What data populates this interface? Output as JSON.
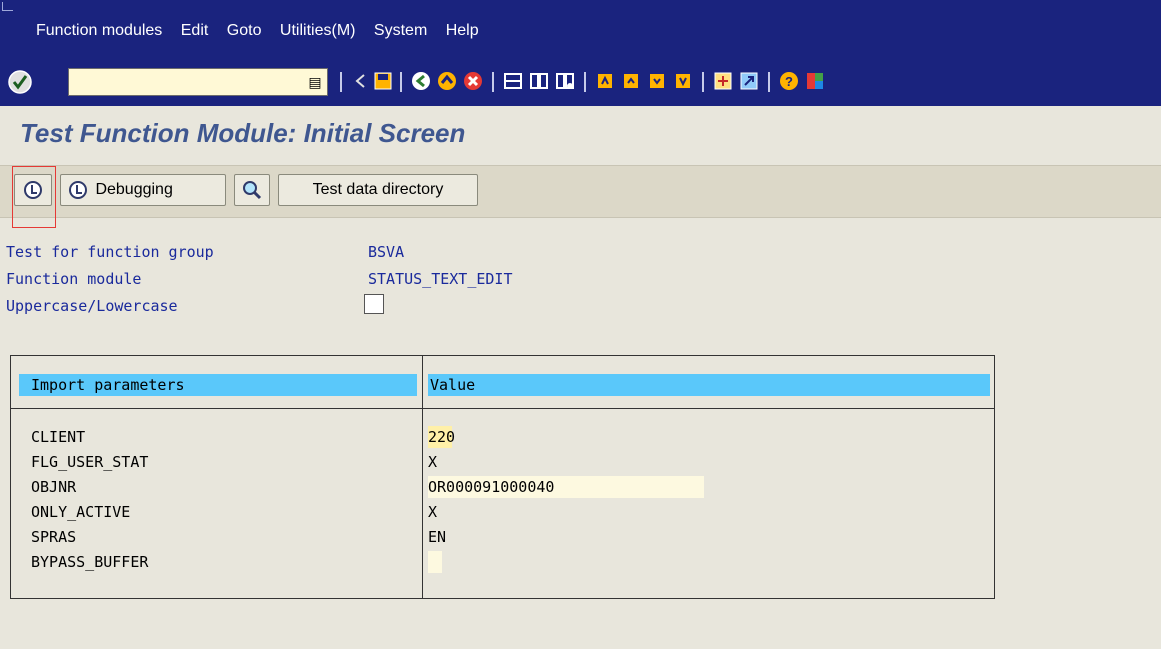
{
  "menu": {
    "items": [
      "Function modules",
      "Edit",
      "Goto",
      "Utilities(M)",
      "System",
      "Help"
    ]
  },
  "toolbar": {
    "command_field_value": "",
    "icons": [
      "enter-icon",
      "back-icon",
      "save-icon",
      "back-green-icon",
      "exit-icon",
      "cancel-icon",
      "print-icon",
      "find-icon",
      "find-next-icon",
      "first-page-icon",
      "prev-page-icon",
      "next-page-icon",
      "last-page-icon",
      "create-session-icon",
      "shortcut-icon",
      "help-icon",
      "customize-layout-icon"
    ]
  },
  "title": "Test Function Module: Initial Screen",
  "app_toolbar": {
    "debugging_label": "Debugging",
    "test_data_label": "Test data directory"
  },
  "fields": {
    "function_group_label": "Test for function group",
    "function_group_value": "BSVA",
    "function_module_label": "Function module",
    "function_module_value": "STATUS_TEXT_EDIT",
    "case_label": "Uppercase/Lowercase"
  },
  "table": {
    "header_param": "Import parameters",
    "header_value": "Value",
    "rows": [
      {
        "name": "CLIENT",
        "value": "220"
      },
      {
        "name": "FLG_USER_STAT",
        "value": "X"
      },
      {
        "name": "OBJNR",
        "value": "OR000091000040"
      },
      {
        "name": "ONLY_ACTIVE",
        "value": "X"
      },
      {
        "name": "SPRAS",
        "value": "EN"
      },
      {
        "name": "BYPASS_BUFFER",
        "value": ""
      }
    ]
  }
}
